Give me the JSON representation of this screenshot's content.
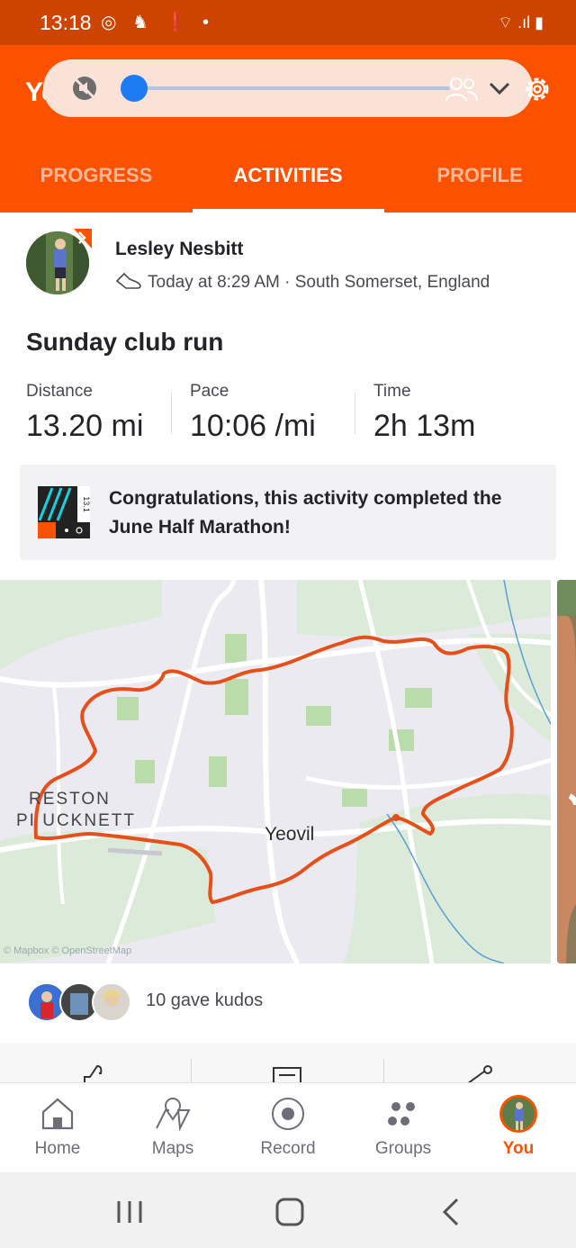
{
  "status_bar": {
    "time": "13:18",
    "icons_left": "◎ ♞ ❗ •",
    "icons_right": "⌔ .ıl ▮"
  },
  "header": {
    "title": "You"
  },
  "tabs": [
    {
      "label": "PROGRESS",
      "active": false
    },
    {
      "label": "ACTIVITIES",
      "active": true
    },
    {
      "label": "PROFILE",
      "active": false
    }
  ],
  "activity": {
    "athlete_name": "Lesley Nesbitt",
    "meta": "Today at 8:29 AM · South Somerset, England",
    "title": "Sunday club run",
    "stats": [
      {
        "label": "Distance",
        "value": "13.20 mi"
      },
      {
        "label": "Pace",
        "value": "10:06 /mi"
      },
      {
        "label": "Time",
        "value": "2h 13m"
      }
    ],
    "achievement": {
      "text": "Congratulations, this activity completed the June Half Marathon!",
      "badge_number": "13.1"
    }
  },
  "map": {
    "labels": {
      "preston": "RESTON",
      "plucknett": "PI UCKNETT",
      "yeovil": "Yeovil"
    },
    "attribution": "© Mapbox © OpenStreetMap",
    "route_color": "#e5501a"
  },
  "kudos": {
    "text": "10 gave kudos"
  },
  "bottom_nav": [
    {
      "label": "Home",
      "icon": "home-icon",
      "active": false
    },
    {
      "label": "Maps",
      "icon": "map-icon",
      "active": false
    },
    {
      "label": "Record",
      "icon": "record-icon",
      "active": false
    },
    {
      "label": "Groups",
      "icon": "groups-icon",
      "active": false
    },
    {
      "label": "You",
      "icon": "profile-avatar",
      "active": true
    }
  ],
  "colors": {
    "brand": "#fc5200",
    "status_bar": "#cc4400",
    "active_tab": "#ffffff",
    "inactive_tab": "#ffb998"
  }
}
